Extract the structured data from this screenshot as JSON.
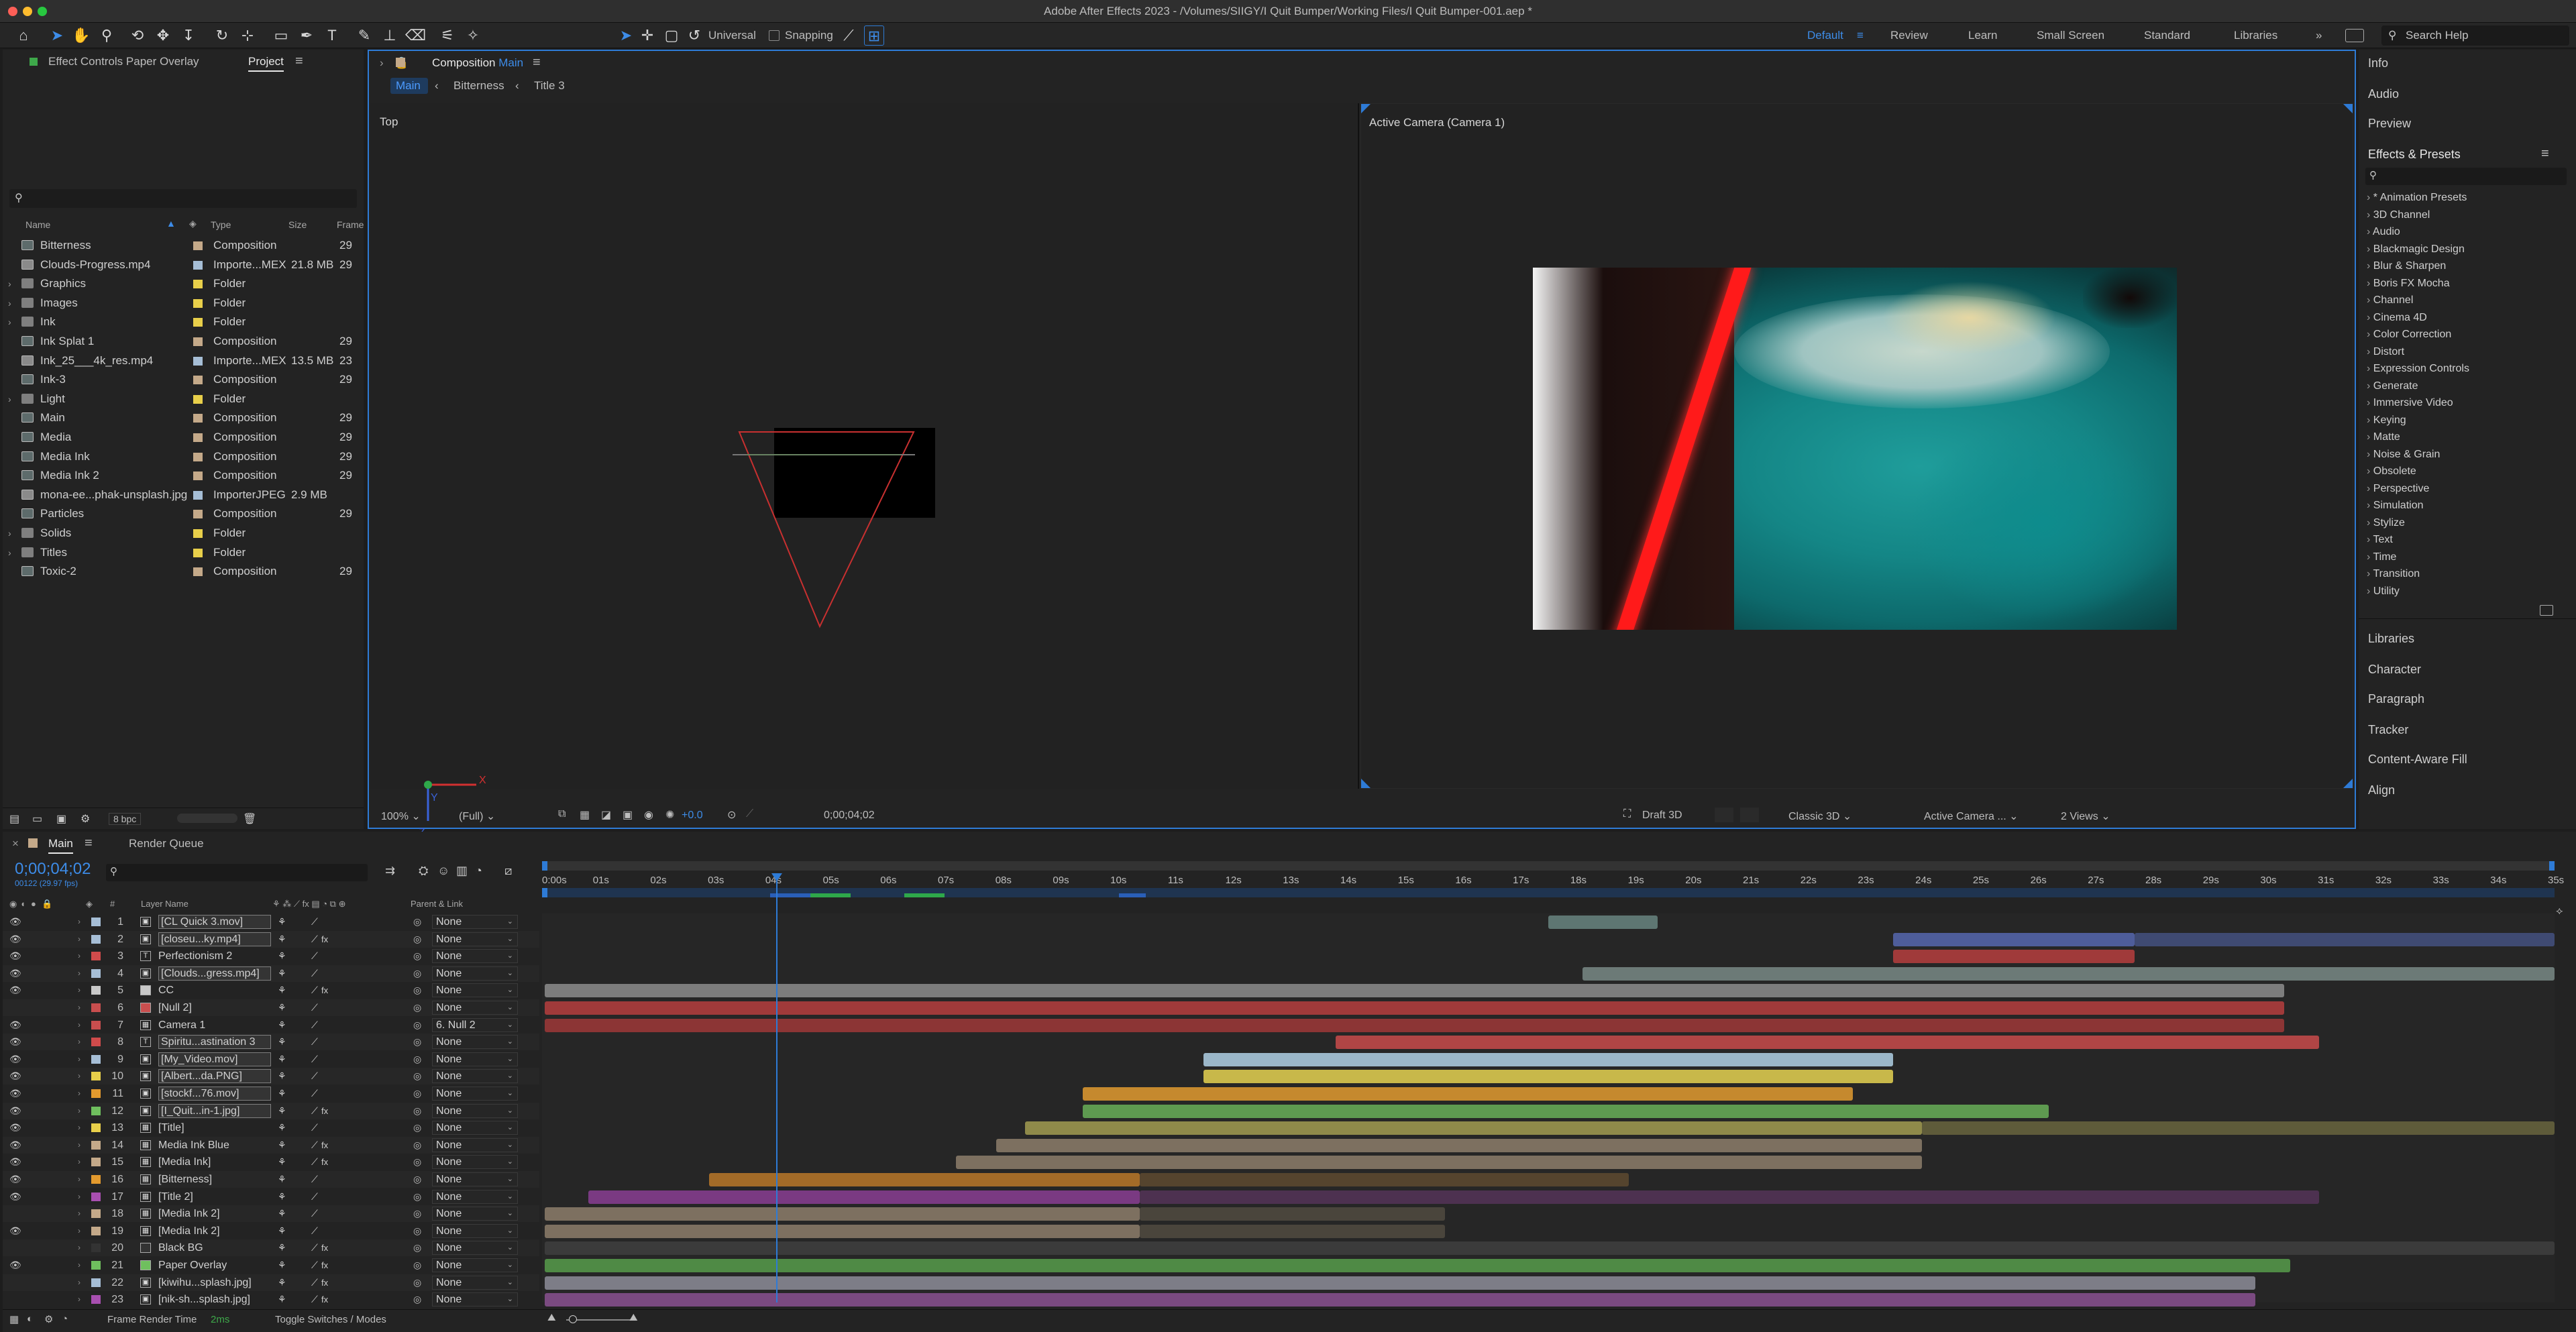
{
  "app_title": "Adobe After Effects 2023 - /Volumes/SIIGY/I Quit Bumper/Working Files/I Quit Bumper-001.aep *",
  "toolbar": {
    "universal_label": "Universal",
    "snapping_label": "Snapping"
  },
  "workspaces": {
    "items": [
      "Default",
      "Review",
      "Learn",
      "Small Screen",
      "Standard",
      "Libraries"
    ],
    "more": "»",
    "search_placeholder": "Search Help"
  },
  "left_panel": {
    "tab_effect_controls": "Effect Controls Paper Overlay",
    "tab_project": "Project",
    "search_placeholder": "",
    "columns": {
      "name": "Name",
      "type": "Type",
      "size": "Size",
      "frame": "Frame"
    },
    "items": [
      {
        "name": "Bitterness",
        "type": "Composition",
        "size": "",
        "frame": "29",
        "color": "#c4a989",
        "kind": "comp",
        "expand": ""
      },
      {
        "name": "Clouds-Progress.mp4",
        "type": "Importe...MEX",
        "size": "21.8 MB",
        "frame": "29",
        "color": "#a6bed6",
        "kind": "footage",
        "expand": ""
      },
      {
        "name": "Graphics",
        "type": "Folder",
        "size": "",
        "frame": "",
        "color": "#e8cf4a",
        "kind": "folder",
        "expand": "›"
      },
      {
        "name": "Images",
        "type": "Folder",
        "size": "",
        "frame": "",
        "color": "#e8cf4a",
        "kind": "folder",
        "expand": "›"
      },
      {
        "name": "Ink",
        "type": "Folder",
        "size": "",
        "frame": "",
        "color": "#e8cf4a",
        "kind": "folder",
        "expand": "›"
      },
      {
        "name": "Ink Splat 1",
        "type": "Composition",
        "size": "",
        "frame": "29",
        "color": "#c4a989",
        "kind": "comp",
        "expand": ""
      },
      {
        "name": "Ink_25___4k_res.mp4",
        "type": "Importe...MEX",
        "size": "13.5 MB",
        "frame": "23",
        "color": "#a6bed6",
        "kind": "footage",
        "expand": ""
      },
      {
        "name": "Ink-3",
        "type": "Composition",
        "size": "",
        "frame": "29",
        "color": "#c4a989",
        "kind": "comp",
        "expand": ""
      },
      {
        "name": "Light",
        "type": "Folder",
        "size": "",
        "frame": "",
        "color": "#e8cf4a",
        "kind": "folder",
        "expand": "›"
      },
      {
        "name": "Main",
        "type": "Composition",
        "size": "",
        "frame": "29",
        "color": "#c4a989",
        "kind": "comp",
        "expand": ""
      },
      {
        "name": "Media",
        "type": "Composition",
        "size": "",
        "frame": "29",
        "color": "#c4a989",
        "kind": "comp",
        "expand": ""
      },
      {
        "name": "Media Ink",
        "type": "Composition",
        "size": "",
        "frame": "29",
        "color": "#c4a989",
        "kind": "comp",
        "expand": ""
      },
      {
        "name": "Media Ink 2",
        "type": "Composition",
        "size": "",
        "frame": "29",
        "color": "#c4a989",
        "kind": "comp",
        "expand": ""
      },
      {
        "name": "mona-ee...phak-unsplash.jpg",
        "type": "ImporterJPEG",
        "size": "2.9 MB",
        "frame": "",
        "color": "#a6bed6",
        "kind": "image",
        "expand": ""
      },
      {
        "name": "Particles",
        "type": "Composition",
        "size": "",
        "frame": "29",
        "color": "#c4a989",
        "kind": "comp",
        "expand": ""
      },
      {
        "name": "Solids",
        "type": "Folder",
        "size": "",
        "frame": "",
        "color": "#e8cf4a",
        "kind": "folder",
        "expand": "›"
      },
      {
        "name": "Titles",
        "type": "Folder",
        "size": "",
        "frame": "",
        "color": "#e8cf4a",
        "kind": "folder",
        "expand": "›"
      },
      {
        "name": "Toxic-2",
        "type": "Composition",
        "size": "",
        "frame": "29",
        "color": "#c4a989",
        "kind": "comp",
        "expand": ""
      }
    ],
    "bpc": "8 bpc"
  },
  "composition": {
    "tab_label": "Composition",
    "tab_comp_name": "Main",
    "breadcrumbs": [
      "Main",
      "Bitterness",
      "Title 3"
    ],
    "view_left_label": "Top",
    "view_right_label": "Active Camera (Camera 1)",
    "footer": {
      "zoom": "100%",
      "resolution": "(Full)",
      "exposure": "+0.0",
      "timecode": "0;00;04;02",
      "renderer": "Draft 3D",
      "renderer_mode": "Classic 3D",
      "camera": "Active Camera ...",
      "views": "2 Views"
    }
  },
  "right_panel": {
    "top_items": [
      "Info",
      "Audio",
      "Preview"
    ],
    "effects_title": "Effects & Presets",
    "effects_search_placeholder": "",
    "effects_items": [
      "* Animation Presets",
      "3D Channel",
      "Audio",
      "Blackmagic Design",
      "Blur & Sharpen",
      "Boris FX Mocha",
      "Channel",
      "Cinema 4D",
      "Color Correction",
      "Distort",
      "Expression Controls",
      "Generate",
      "Immersive Video",
      "Keying",
      "Matte",
      "Noise & Grain",
      "Obsolete",
      "Perspective",
      "Simulation",
      "Stylize",
      "Text",
      "Time",
      "Transition",
      "Utility"
    ],
    "bottom_items": [
      "Libraries",
      "Character",
      "Paragraph",
      "Tracker",
      "Content-Aware Fill",
      "Align"
    ]
  },
  "timeline": {
    "tab_main": "Main",
    "tab_render": "Render Queue",
    "timecode": "0;00;04;02",
    "subtime": "00122 (29.97 fps)",
    "search_placeholder": "",
    "columns": {
      "num": "#",
      "name": "Layer Name",
      "parent": "Parent & Link"
    },
    "ruler_labels": [
      "0:00s",
      "01s",
      "02s",
      "03s",
      "04s",
      "05s",
      "06s",
      "07s",
      "08s",
      "09s",
      "10s",
      "11s",
      "12s",
      "13s",
      "14s",
      "15s",
      "16s",
      "17s",
      "18s",
      "19s",
      "20s",
      "21s",
      "22s",
      "23s",
      "24s",
      "25s",
      "26s",
      "27s",
      "28s",
      "29s",
      "30s",
      "31s",
      "32s",
      "33s",
      "34s",
      "35s"
    ],
    "playhead_seconds": 4.07,
    "duration_seconds": 35,
    "footer": {
      "frame_render_label": "Frame Render Time",
      "frame_render_value": "2ms",
      "toggle_label": "Toggle Switches / Modes"
    },
    "layers": [
      {
        "n": "1",
        "name": "[CL Quick 3.mov]",
        "type": "F",
        "color": "#a6bed6",
        "parent": "None",
        "fx": "",
        "eye": "👁",
        "boxed": true,
        "bar": {
          "color": "#5e7672",
          "start": 17.5,
          "end": 19.4
        },
        "bar2": null
      },
      {
        "n": "2",
        "name": "[closeu...ky.mp4]",
        "type": "F",
        "color": "#a6bed6",
        "parent": "None",
        "fx": "fx",
        "eye": "👁",
        "boxed": true,
        "bar": {
          "color": "#4e5d9a",
          "start": 23.5,
          "end": 27.7
        },
        "bar2": {
          "color": "#3f4a72",
          "start": 27.7,
          "end": 35
        }
      },
      {
        "n": "3",
        "name": "Perfectionism 2",
        "type": "T",
        "color": "#d04b4b",
        "parent": "None",
        "fx": "",
        "eye": "👁",
        "boxed": false,
        "bar": {
          "color": "#a03a3a",
          "start": 23.5,
          "end": 27.7
        },
        "bar2": null
      },
      {
        "n": "4",
        "name": "[Clouds...gress.mp4]",
        "type": "F",
        "color": "#a6bed6",
        "parent": "None",
        "fx": "",
        "eye": "👁",
        "boxed": true,
        "bar": {
          "color": "#6c7a77",
          "start": 18.1,
          "end": 35
        },
        "bar2": null
      },
      {
        "n": "5",
        "name": "CC",
        "type": "S",
        "color": "#c8c8c8",
        "parent": "None",
        "fx": "fx",
        "eye": "👁",
        "boxed": false,
        "bar": {
          "color": "#7d7d7d",
          "start": 0.05,
          "end": 30.3
        },
        "bar2": null
      },
      {
        "n": "6",
        "name": "[Null 2]",
        "type": "S",
        "color": "#c84e4e",
        "parent": "None",
        "fx": "",
        "eye": "",
        "boxed": false,
        "bar": {
          "color": "#a03a3a",
          "start": 0.05,
          "end": 30.3
        },
        "bar2": null
      },
      {
        "n": "7",
        "name": "Camera 1",
        "type": "C",
        "color": "#c84e4e",
        "parent": "6. Null 2",
        "fx": "",
        "eye": "👁",
        "boxed": false,
        "bar": {
          "color": "#8c3535",
          "start": 0.05,
          "end": 30.3
        },
        "bar2": null
      },
      {
        "n": "8",
        "name": "Spiritu...astination 3",
        "type": "T",
        "color": "#d04b4b",
        "parent": "None",
        "fx": "",
        "eye": "👁",
        "boxed": true,
        "bar": {
          "color": "#b04545",
          "start": 13.8,
          "end": 30.9
        },
        "bar2": null
      },
      {
        "n": "9",
        "name": "[My_Video.mov]",
        "type": "F",
        "color": "#a6bed6",
        "parent": "None",
        "fx": "",
        "eye": "👁",
        "boxed": true,
        "bar": {
          "color": "#9bb7c9",
          "start": 11.5,
          "end": 23.5
        },
        "bar2": null
      },
      {
        "n": "10",
        "name": "[Albert...da.PNG]",
        "type": "F",
        "color": "#e8cf4a",
        "parent": "None",
        "fx": "",
        "eye": "👁",
        "boxed": true,
        "bar": {
          "color": "#c8b84a",
          "start": 11.5,
          "end": 23.5
        },
        "bar2": null
      },
      {
        "n": "11",
        "name": "[stockf...76.mov]",
        "type": "F",
        "color": "#e39a2e",
        "parent": "None",
        "fx": "",
        "eye": "👁",
        "boxed": true,
        "bar": {
          "color": "#c5892e",
          "start": 9.4,
          "end": 22.8
        },
        "bar2": null
      },
      {
        "n": "12",
        "name": "[I_Quit...in-1.jpg]",
        "type": "F",
        "color": "#6fbf5e",
        "parent": "None",
        "fx": "fx",
        "eye": "👁",
        "boxed": true,
        "bar": {
          "color": "#5e9a50",
          "start": 9.4,
          "end": 26.2
        },
        "bar2": null
      },
      {
        "n": "13",
        "name": "[Title]",
        "type": "C",
        "color": "#e8cf4a",
        "parent": "None",
        "fx": "",
        "eye": "👁",
        "boxed": false,
        "bar": {
          "color": "#8f8a4a",
          "start": 8.4,
          "end": 24.0
        },
        "bar2": {
          "color": "#5e5b3a",
          "start": 24.0,
          "end": 35
        }
      },
      {
        "n": "14",
        "name": "Media Ink Blue",
        "type": "C",
        "color": "#c4a989",
        "parent": "None",
        "fx": "fx",
        "eye": "👁",
        "boxed": false,
        "bar": {
          "color": "#7d7060",
          "start": 7.9,
          "end": 24.0
        },
        "bar2": null
      },
      {
        "n": "15",
        "name": "[Media Ink]",
        "type": "C",
        "color": "#c4a989",
        "parent": "None",
        "fx": "fx",
        "eye": "👁",
        "boxed": false,
        "bar": {
          "color": "#7d7060",
          "start": 7.2,
          "end": 24.0
        },
        "bar2": null
      },
      {
        "n": "16",
        "name": "[Bitterness]",
        "type": "C",
        "color": "#e39a2e",
        "parent": "None",
        "fx": "",
        "eye": "👁",
        "boxed": false,
        "bar": {
          "color": "#a36b28",
          "start": 2.9,
          "end": 10.4
        },
        "bar2": {
          "color": "#55442e",
          "start": 10.4,
          "end": 18.9
        }
      },
      {
        "n": "17",
        "name": "[Title 2]",
        "type": "C",
        "color": "#a84fb0",
        "parent": "None",
        "fx": "",
        "eye": "👁",
        "boxed": false,
        "bar": {
          "color": "#7a3a82",
          "start": 0.8,
          "end": 10.4
        },
        "bar2": {
          "color": "#4d3150",
          "start": 10.4,
          "end": 30.9
        }
      },
      {
        "n": "18",
        "name": "[Media Ink 2]",
        "type": "C",
        "color": "#c4a989",
        "parent": "None",
        "fx": "",
        "eye": "",
        "boxed": false,
        "bar": {
          "color": "#7d7060",
          "start": 0.05,
          "end": 10.4
        },
        "bar2": {
          "color": "#4a453c",
          "start": 10.4,
          "end": 15.7
        }
      },
      {
        "n": "19",
        "name": "[Media Ink 2]",
        "type": "C",
        "color": "#c4a989",
        "parent": "None",
        "fx": "",
        "eye": "👁",
        "boxed": false,
        "bar": {
          "color": "#7d7060",
          "start": 0.05,
          "end": 10.4
        },
        "bar2": {
          "color": "#4a453c",
          "start": 10.4,
          "end": 15.7
        }
      },
      {
        "n": "20",
        "name": "Black BG",
        "type": "S",
        "color": "#333333",
        "parent": "None",
        "fx": "fx",
        "eye": "",
        "boxed": false,
        "bar": {
          "color": "#3b3b3b",
          "start": 0.05,
          "end": 35
        },
        "bar2": null
      },
      {
        "n": "21",
        "name": "Paper Overlay",
        "type": "S",
        "color": "#6fbf5e",
        "parent": "None",
        "fx": "fx",
        "eye": "👁",
        "boxed": false,
        "bar": {
          "color": "#4f8a45",
          "start": 0.05,
          "end": 30.4
        },
        "bar2": null
      },
      {
        "n": "22",
        "name": "[kiwihu...splash.jpg]",
        "type": "F",
        "color": "#a6bed6",
        "parent": "None",
        "fx": "fx",
        "eye": "",
        "boxed": false,
        "bar": {
          "color": "#7d7d87",
          "start": 0.05,
          "end": 29.8
        },
        "bar2": null
      },
      {
        "n": "23",
        "name": "[nik-sh...splash.jpg]",
        "type": "F",
        "color": "#a84fb0",
        "parent": "None",
        "fx": "fx",
        "eye": "",
        "boxed": false,
        "bar": {
          "color": "#7a4a80",
          "start": 0.05,
          "end": 29.8
        },
        "bar2": null
      }
    ]
  },
  "colors": {
    "accent": "#2e7bd6",
    "panel_bg": "#232323",
    "app_bg": "#1d1d1d"
  }
}
